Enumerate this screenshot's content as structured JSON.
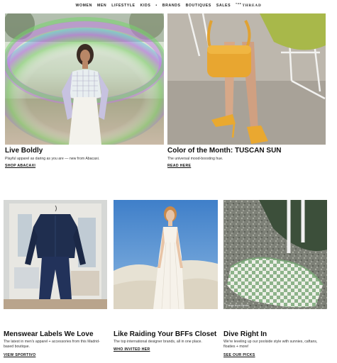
{
  "nav": {
    "items": [
      "WOMEN",
      "MEN",
      "LIFESTYLE",
      "KIDS",
      "•",
      "BRANDS",
      "BOUTIQUES",
      "SALES"
    ],
    "logo_small": "THE",
    "logo": "THREAD"
  },
  "cards": [
    {
      "title": "Live Boldly",
      "description": "Playful apparel as daring as you are — new from Abacaxi.",
      "cta": "SHOP ABACAXI",
      "image": "woman-in-gingham-top-under-rainbow-bubble"
    },
    {
      "title": "Color of the Month: TUSCAN SUN",
      "description": "The universal mood-boosting hue.",
      "cta": "READ HERE",
      "image": "yellow-bag-and-heeled-sandals"
    },
    {
      "title": "Menswear Labels We Love",
      "description": "The latest in men's apparel + accessories from this Madrid-based boutique.",
      "cta": "VIEW SPORTIVO",
      "image": "navy-workwear-suit-on-hanger"
    },
    {
      "title": "Like Raiding Your BFFs Closet",
      "description": "The top international designer brands, all in one place.",
      "cta": "WHO INVITED HER",
      "image": "woman-in-white-dress-on-dunes"
    },
    {
      "title": "Dive Right In",
      "description": "We're leveling up our poolside style with sunnies, caftans, floaties + more!",
      "cta": "SEE OUR PICKS",
      "image_credit": "Things from Bente",
      "image": "green-checkered-towel-by-pool"
    }
  ],
  "colors": {
    "text": "#111111",
    "tuscan_sun": "#E8A630",
    "towel_green": "#8DB38A",
    "suit_navy": "#1F2E4F"
  }
}
